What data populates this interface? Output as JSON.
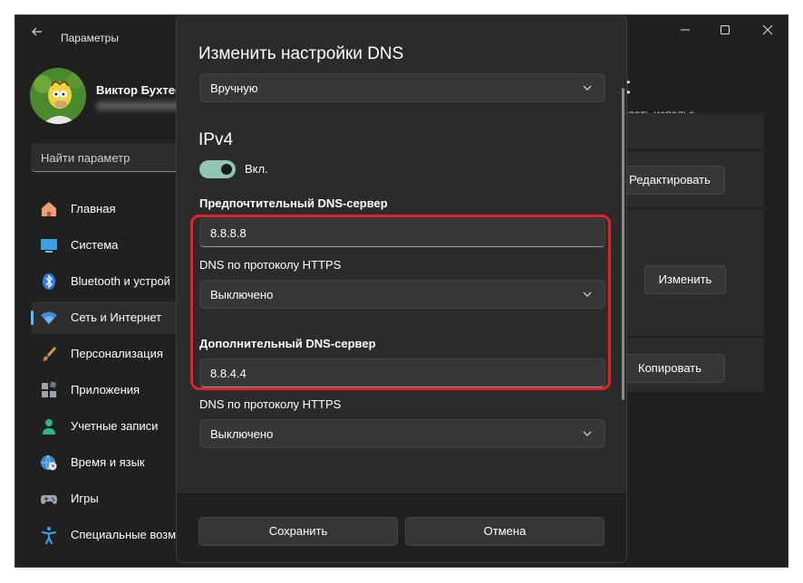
{
  "window": {
    "back_icon": "arrow-left-icon",
    "title": "Параметры",
    "controls": [
      "minimize-icon",
      "maximize-icon",
      "close-icon"
    ]
  },
  "profile": {
    "name": "Виктор Бухтее"
  },
  "search": {
    "placeholder": "Найти параметр"
  },
  "sidebar": {
    "items": [
      {
        "label": "Главная",
        "icon": "home-icon"
      },
      {
        "label": "Система",
        "icon": "display-icon"
      },
      {
        "label": "Bluetooth и устрой",
        "icon": "bluetooth-icon"
      },
      {
        "label": "Сеть и Интернет",
        "icon": "wifi-icon",
        "active": true
      },
      {
        "label": "Персонализация",
        "icon": "brush-icon"
      },
      {
        "label": "Приложения",
        "icon": "apps-icon"
      },
      {
        "label": "Учетные записи",
        "icon": "user-icon"
      },
      {
        "label": "Время и язык",
        "icon": "globe-clock-icon"
      },
      {
        "label": "Игры",
        "icon": "gamepad-icon"
      },
      {
        "label": "Специальные возм",
        "icon": "accessibility-icon"
      }
    ]
  },
  "background": {
    "heading": "et",
    "subtext": "овать использ",
    "edit_button": "Редактировать",
    "change_button": "Изменить",
    "copy_button": "Копировать"
  },
  "dialog": {
    "title": "Изменить настройки DNS",
    "mode_value": "Вручную",
    "ipv4_title": "IPv4",
    "toggle_label": "Вкл.",
    "toggle_on": true,
    "preferred_label": "Предпочтительный DNS-сервер",
    "preferred_value": "8.8.8.8",
    "https_label_1": "DNS по протоколу HTTPS",
    "https_value_1": "Выключено",
    "alternate_label": "Дополнительный DNS-сервер",
    "alternate_value": "8.8.4.4",
    "https_label_2": "DNS по протоколу HTTPS",
    "https_value_2": "Выключено",
    "save_button": "Сохранить",
    "cancel_button": "Отмена"
  },
  "colors": {
    "accent": "#4cc2ff",
    "toggle": "#8ec5b4",
    "highlight": "#e5202b"
  }
}
